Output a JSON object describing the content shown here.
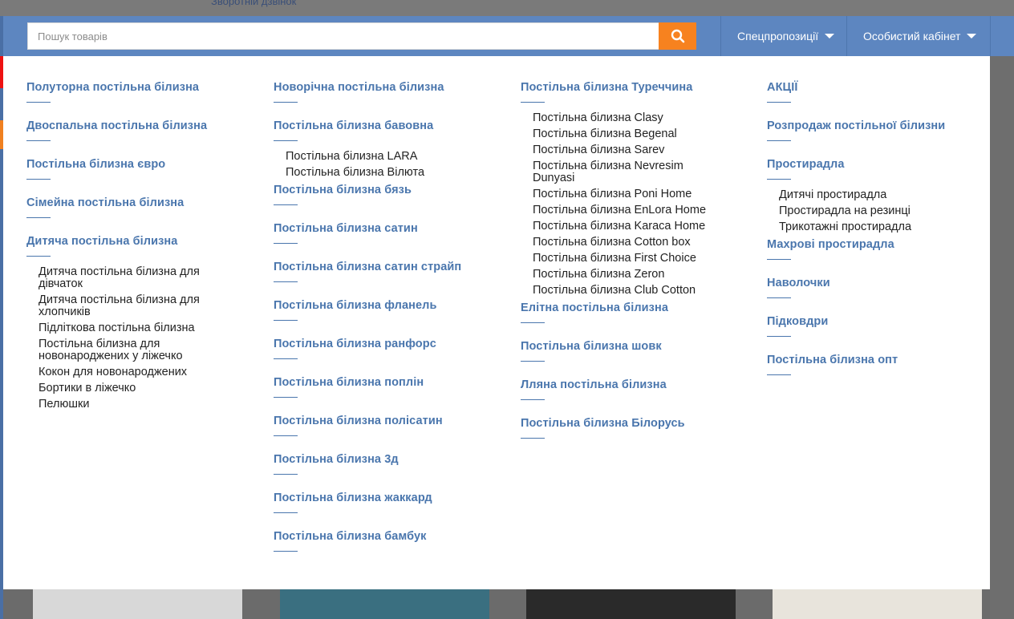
{
  "topbar": {
    "callback_label": "Зворотній дзвінок"
  },
  "header": {
    "search": {
      "placeholder": "Пошук товарів",
      "value": ""
    },
    "nav": [
      {
        "label": "Спецпропозиції"
      },
      {
        "label": "Особистий кабінет"
      }
    ]
  },
  "colors": {
    "header": "#5d86c0",
    "search_button": "#f7821f",
    "category_link": "#4a76ad"
  },
  "menu": {
    "col1": [
      {
        "label": "Полуторна постільна білизна"
      },
      {
        "label": "Двоспальна постільна білизна"
      },
      {
        "label": "Постільна білизна євро"
      },
      {
        "label": "Сімейна постільна білизна"
      },
      {
        "label": "Дитяча постільна білизна",
        "subs": [
          "Дитяча постільна білизна для дівчаток",
          "Дитяча постільна білизна для хлопчиків",
          "Підліткова постільна білизна",
          "Постільна білизна для новонароджених у ліжечко",
          "Кокон для новонароджених",
          "Бортики в ліжечко",
          "Пелюшки"
        ]
      }
    ],
    "col2": [
      {
        "label": "Новорічна постільна білизна"
      },
      {
        "label": "Постільна білизна бавовна",
        "subs": [
          "Постільна білизна LARA",
          "Постільна білизна Вілюта"
        ]
      },
      {
        "label": "Постільна білизна бязь"
      },
      {
        "label": "Постільна білизна сатин"
      },
      {
        "label": "Постільна білизна сатин страйп"
      },
      {
        "label": "Постільна білизна фланель"
      },
      {
        "label": "Постільна білизна ранфорс"
      },
      {
        "label": "Постільна білизна поплін"
      },
      {
        "label": "Постільна білизна полісатин"
      },
      {
        "label": "Постільна білизна 3д"
      },
      {
        "label": "Постільна білизна жаккард"
      },
      {
        "label": "Постільна білизна бамбук"
      }
    ],
    "col3": [
      {
        "label": "Постільна білизна Туреччина",
        "subs": [
          "Постільна білизна Clasy",
          "Постільна білизна Begenal",
          "Постільна білизна Sarev",
          "Постільна білизна Nevresim Dunyasi",
          "Постільна білизна Poni Home",
          "Постільна білизна EnLora Home",
          "Постільна білизна Karaca Home",
          "Постільна білизна Cotton box",
          "Постільна білизна First Choice",
          "Постільна білизна Zeron",
          "Постільна білизна Club Cotton"
        ]
      },
      {
        "label": "Елітна постільна білизна"
      },
      {
        "label": "Постільна білизна шовк"
      },
      {
        "label": "Лляна постільна білизна"
      },
      {
        "label": "Постільна білизна Білорусь"
      }
    ],
    "col4": [
      {
        "label": "АКЦІЇ"
      },
      {
        "label": "Розпродаж постільної білизни"
      },
      {
        "label": "Простирадла",
        "subs": [
          "Дитячі простирадла",
          "Простирадла на резинці",
          "Трикотажні простирадла"
        ]
      },
      {
        "label": "Махрові простирадла"
      },
      {
        "label": "Наволочки"
      },
      {
        "label": "Підковдри"
      },
      {
        "label": "Постільна білизна опт"
      }
    ]
  }
}
